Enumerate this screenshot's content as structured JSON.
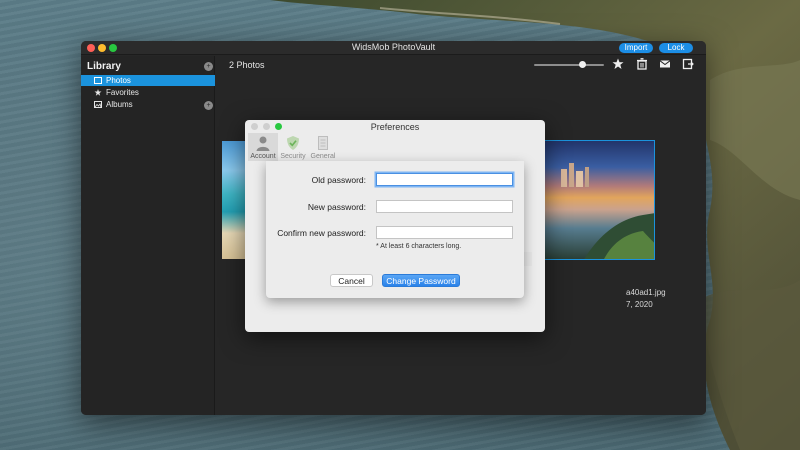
{
  "window": {
    "title": "WidsMob PhotoVault",
    "buttons": {
      "import": "Import",
      "lock": "Lock"
    }
  },
  "sidebar": {
    "title": "Library",
    "title_badge": "+",
    "items": [
      {
        "label": "Photos",
        "icon": "photo-icon",
        "active": true
      },
      {
        "label": "Favorites",
        "icon": "star-icon",
        "active": false
      },
      {
        "label": "Albums",
        "icon": "album-icon",
        "active": false,
        "badge": "+"
      }
    ]
  },
  "main": {
    "photo_count": "2 Photos",
    "zoom_level": 0.65,
    "toolbar": [
      "star-icon",
      "trash-icon",
      "mail-icon",
      "export-icon"
    ],
    "thumb_caption": {
      "name": "a40ad1.jpg",
      "date": "7, 2020"
    }
  },
  "preferences": {
    "title": "Preferences",
    "tabs": [
      {
        "label": "Account",
        "icon": "account-icon",
        "active": true
      },
      {
        "label": "Security",
        "icon": "shield-icon",
        "active": false
      },
      {
        "label": "General",
        "icon": "general-icon",
        "active": false
      }
    ],
    "form": {
      "old_password_label": "Old password:",
      "new_password_label": "New password:",
      "confirm_password_label": "Confirm new password:",
      "old_password_value": "",
      "new_password_value": "",
      "confirm_password_value": "",
      "hint": "* At least 6 characters long.",
      "cancel": "Cancel",
      "submit": "Change Password"
    }
  },
  "colors": {
    "accent": "#1b93dd",
    "primary_button": "#2a82ea",
    "focus_ring": "#7fb6f3"
  }
}
